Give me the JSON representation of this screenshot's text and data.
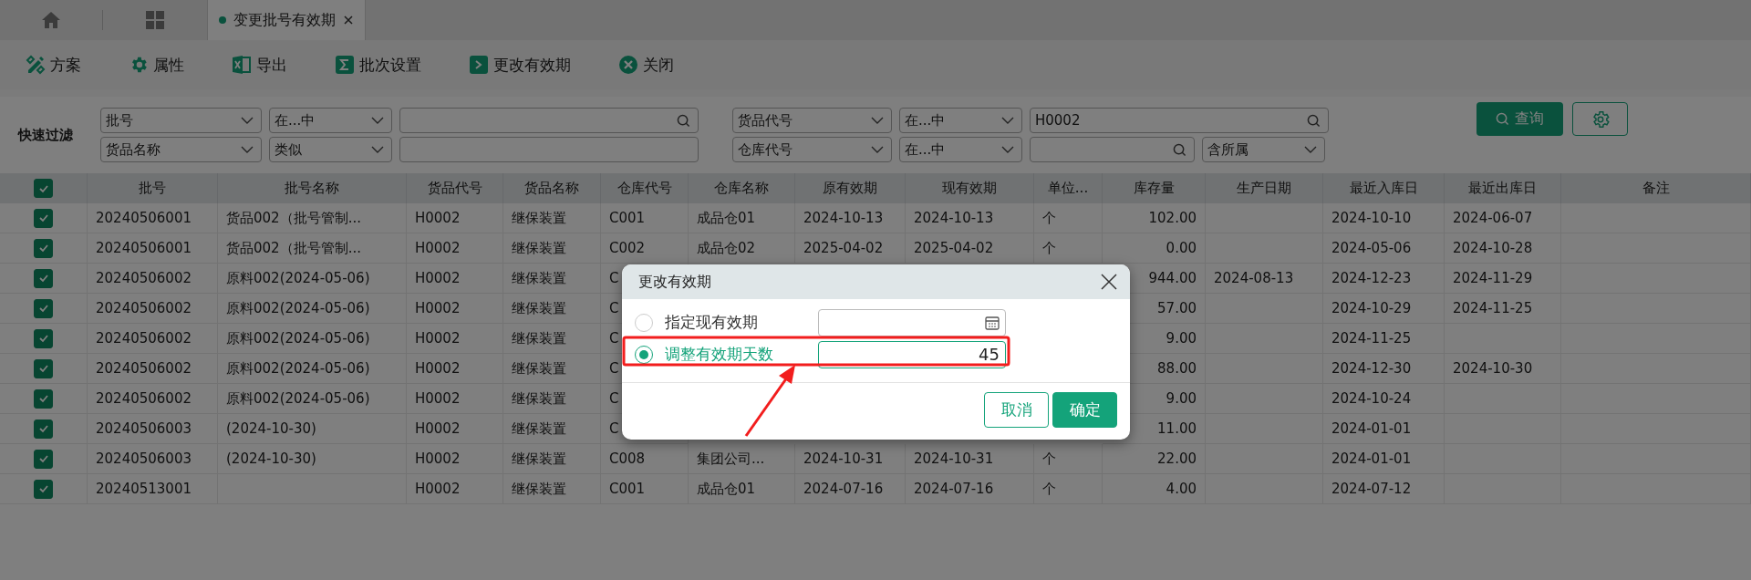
{
  "tabs": [
    {
      "kind": "home",
      "selected": false
    },
    {
      "kind": "apps",
      "selected": false
    },
    {
      "kind": "page",
      "label": "变更批号有效期",
      "selected": true
    }
  ],
  "toolbar": [
    {
      "kind": "plan",
      "label": "方案"
    },
    {
      "kind": "gear",
      "label": "属性"
    },
    {
      "kind": "sheet",
      "label": "导出"
    },
    {
      "kind": "sigma",
      "label": "批次设置"
    },
    {
      "kind": "prompt",
      "label": "更改有效期"
    },
    {
      "kind": "close",
      "label": "关闭"
    }
  ],
  "filter": {
    "label": "快速过滤",
    "rows": [
      [
        {
          "kind": "select",
          "value": "批号"
        },
        {
          "kind": "select",
          "value": "在...中"
        },
        {
          "kind": "search"
        },
        {
          "kind": "select",
          "value": "货品代号"
        },
        {
          "kind": "select",
          "value": "在...中"
        },
        {
          "kind": "search",
          "value": "H0002"
        }
      ],
      [
        {
          "kind": "select",
          "value": "货品名称"
        },
        {
          "kind": "select",
          "value": "类似"
        },
        {
          "kind": "text"
        },
        {
          "kind": "select",
          "value": "仓库代号"
        },
        {
          "kind": "select",
          "value": "在...中"
        },
        {
          "kind": "search"
        },
        {
          "kind": "select",
          "value": "含所属"
        }
      ]
    ],
    "query_button": "查询"
  },
  "table": {
    "all_checked": true,
    "columns": [
      "批号",
      "批号名称",
      "货品代号",
      "货品名称",
      "仓库代号",
      "仓库名称",
      "原有效期",
      "现有效期",
      "单位...",
      "库存量",
      "生产日期",
      "最近入库日",
      "最近出库日",
      "备注"
    ],
    "rows": [
      {
        "checked": true,
        "cells": [
          "20240506001",
          "货品002（批号管制...",
          "H0002",
          "继保装置",
          "C001",
          "成品仓01",
          "2024-10-13",
          "2024-10-13",
          "个",
          "102.00",
          null,
          "2024-10-10",
          "2024-06-07",
          null
        ]
      },
      {
        "checked": true,
        "cells": [
          "20240506001",
          "货品002（批号管制...",
          "H0002",
          "继保装置",
          "C002",
          "成品仓02",
          "2025-04-02",
          "2025-04-02",
          "个",
          "0.00",
          null,
          "2024-05-06",
          "2024-10-28",
          null
        ]
      },
      {
        "checked": true,
        "cells": [
          "20240506002",
          "原料002(2024-05-06)",
          "H0002",
          "继保装置",
          "C",
          null,
          null,
          null,
          null,
          "944.00",
          "2024-08-13",
          "2024-12-23",
          "2024-11-29",
          null
        ]
      },
      {
        "checked": true,
        "cells": [
          "20240506002",
          "原料002(2024-05-06)",
          "H0002",
          "继保装置",
          "C",
          null,
          null,
          null,
          null,
          "57.00",
          null,
          "2024-10-29",
          "2024-11-25",
          null
        ]
      },
      {
        "checked": true,
        "cells": [
          "20240506002",
          "原料002(2024-05-06)",
          "H0002",
          "继保装置",
          "C",
          null,
          null,
          null,
          null,
          "9.00",
          null,
          "2024-11-25",
          null,
          null
        ]
      },
      {
        "checked": true,
        "cells": [
          "20240506002",
          "原料002(2024-05-06)",
          "H0002",
          "继保装置",
          "C",
          null,
          null,
          null,
          null,
          "88.00",
          null,
          "2024-12-30",
          "2024-10-30",
          null
        ]
      },
      {
        "checked": true,
        "cells": [
          "20240506002",
          "原料002(2024-05-06)",
          "H0002",
          "继保装置",
          "C",
          null,
          null,
          null,
          null,
          "9.00",
          null,
          "2024-10-24",
          null,
          null
        ]
      },
      {
        "checked": true,
        "cells": [
          "20240506003",
          "(2024-10-30)",
          "H0002",
          "继保装置",
          "C",
          null,
          null,
          null,
          null,
          "11.00",
          null,
          "2024-01-01",
          null,
          null
        ]
      },
      {
        "checked": true,
        "cells": [
          "20240506003",
          "(2024-10-30)",
          "H0002",
          "继保装置",
          "C008",
          "集团公司...",
          "2024-10-31",
          "2024-10-31",
          "个",
          "22.00",
          null,
          "2024-01-01",
          null,
          null
        ]
      },
      {
        "checked": true,
        "cells": [
          "20240513001",
          null,
          "H0002",
          "继保装置",
          "C001",
          "成品仓01",
          "2024-07-16",
          "2024-07-16",
          "个",
          "4.00",
          null,
          "2024-07-12",
          null,
          null
        ]
      }
    ]
  },
  "dialog": {
    "title": "更改有效期",
    "options": [
      {
        "kind": "date",
        "label": "指定现有效期",
        "selected": false
      },
      {
        "kind": "number",
        "label": "调整有效期天数",
        "selected": true,
        "value": "45"
      }
    ],
    "buttons": [
      {
        "kind": "secondary",
        "label": "取消"
      },
      {
        "kind": "primary",
        "label": "确定"
      }
    ]
  }
}
